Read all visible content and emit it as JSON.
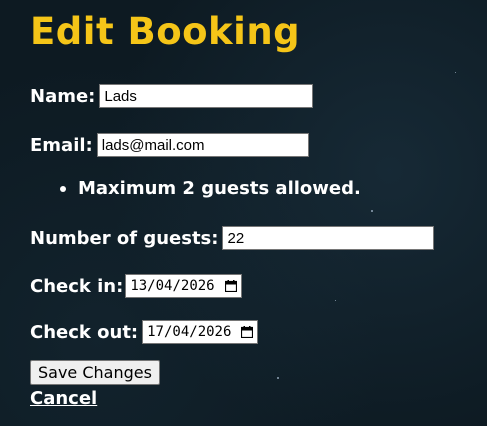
{
  "page": {
    "title": "Edit Booking"
  },
  "form": {
    "name_label": "Name:",
    "name_value": "Lads",
    "email_label": "Email:",
    "email_value": "lads@mail.com",
    "note": "Maximum 2 guests allowed.",
    "guests_label": "Number of guests:",
    "guests_value": "22",
    "checkin_label": "Check in:",
    "checkin_value": "13/04/2026",
    "checkout_label": "Check out:",
    "checkout_value": "17/04/2026",
    "save_label": "Save Changes",
    "cancel_label": "Cancel"
  },
  "colors": {
    "title": "#f5c518",
    "background": "#0d1a22",
    "text": "#ffffff"
  },
  "icons": {
    "date_picker": "calendar-icon"
  }
}
